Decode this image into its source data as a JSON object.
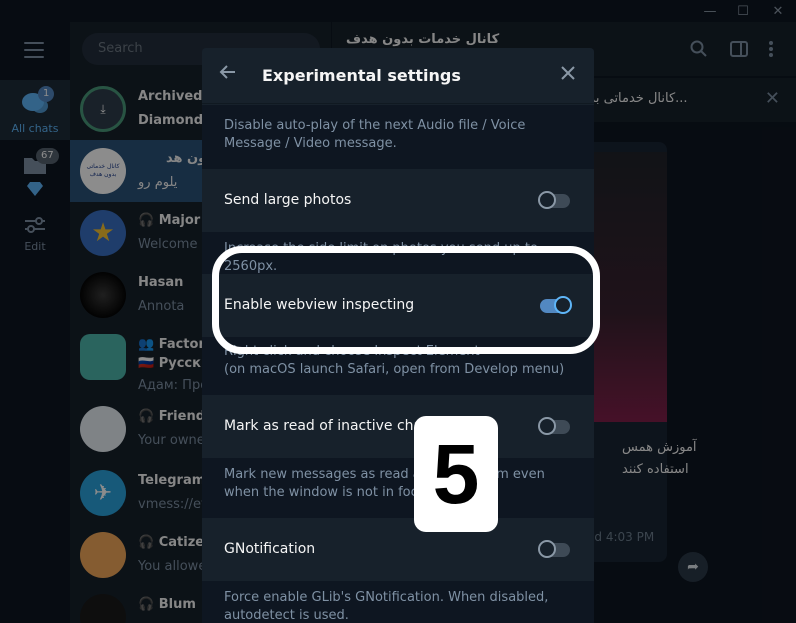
{
  "window": {
    "controls": [
      "—",
      "☐",
      "✕"
    ]
  },
  "folders": {
    "items": [
      {
        "label": "All chats",
        "badge": "1",
        "icon": "chats-icon"
      },
      {
        "label": "",
        "badge": "67",
        "icon": "folder-icon"
      },
      {
        "label": "Edit",
        "icon": "edit-icon"
      }
    ]
  },
  "search": {
    "placeholder": "Search"
  },
  "chats": [
    {
      "name": "Archived c",
      "preview": "Diamond H",
      "avatar_text": "⤓"
    },
    {
      "name": "بدون هد 📢",
      "preview": "یلوم رو",
      "avatar_text": "کانال خدماتی بدون هدف"
    },
    {
      "name": "🎧 Major ",
      "preview": "Welcome t",
      "avatar_text": "★"
    },
    {
      "name": "Hasan",
      "preview": "Annota",
      "avatar_text": ""
    },
    {
      "name": "👥 Factor",
      "preview": "🇷🇺 Русски",
      "preview2": "Адам: Про",
      "avatar_text": ""
    },
    {
      "name": "🎧 Friends",
      "preview": "Your owne",
      "avatar_text": ""
    },
    {
      "name": "Telegram",
      "preview": "vmess://ey",
      "avatar_text": "✈"
    },
    {
      "name": "🎧 Catizen",
      "preview": "You allowe",
      "avatar_text": ""
    },
    {
      "name": "🎧 Blum",
      "preview": "",
      "avatar_text": ""
    }
  ],
  "chatpane": {
    "title": "کانال خدمات بدون هدف",
    "pinned_text": "کانال خدماتی بدون هدف د...",
    "message_text_1": "آموزش همس",
    "message_text_2": "استفاده کنند",
    "message_time": "ed 4:03 PM"
  },
  "dialog": {
    "title": "Experimental settings",
    "items": [
      {
        "type": "desc",
        "text": "Disable auto-play of the next Audio file / Voice Message / Video message."
      },
      {
        "type": "toggle",
        "label": "Send large photos",
        "on": false
      },
      {
        "type": "desc",
        "text": "Increase the side limit on photos you send up to 2560px."
      },
      {
        "type": "toggle",
        "label": "Enable webview inspecting",
        "on": true
      },
      {
        "type": "desc",
        "text": "Right click and choose Inspect Element"
      },
      {
        "type": "desc",
        "text": "(on macOS launch Safari, open from Develop menu)"
      },
      {
        "type": "toggle",
        "label": "Mark as read of inactive chat",
        "on": false
      },
      {
        "type": "desc",
        "text": "Mark new messages as read and read them even when the window is not in focus."
      },
      {
        "type": "toggle",
        "label": "GNotification",
        "on": false
      },
      {
        "type": "desc",
        "text": "Force enable GLib's GNotification. When disabled, autodetect is used."
      }
    ]
  },
  "annotation": {
    "step_number": "5"
  },
  "colors": {
    "accent": "#5288c1",
    "bg": "#17212b",
    "bg_dark": "#0e1621"
  }
}
